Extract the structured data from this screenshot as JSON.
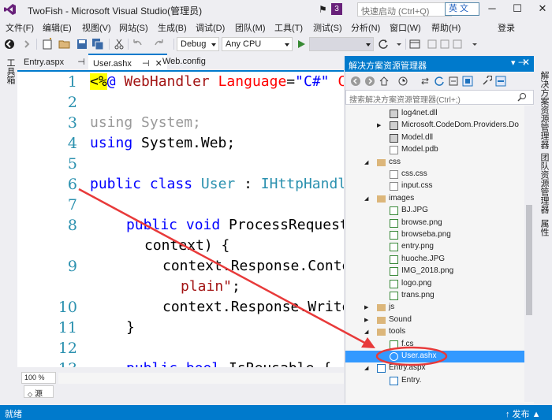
{
  "window": {
    "title": "TwoFish - Microsoft Visual Studio(管理员)",
    "notification_count": "3",
    "quick_launch_placeholder": "快速启动 (Ctrl+Q)",
    "ime_label": "英 文"
  },
  "menu": {
    "items": [
      "文件(F)",
      "编辑(E)",
      "视图(V)",
      "网站(S)",
      "生成(B)",
      "调试(D)",
      "团队(M)",
      "工具(T)",
      "测试(S)",
      "分析(N)",
      "窗口(W)",
      "帮助(H)"
    ],
    "login": "登录"
  },
  "toolbar": {
    "config": "Debug",
    "platform": "Any CPU"
  },
  "left_strip": {
    "toolbox": "工具箱"
  },
  "tabs": [
    {
      "label": "Entry.aspx",
      "pin": "⊣",
      "active": false
    },
    {
      "label": "User.ashx",
      "pin": "⊣",
      "close": "✕",
      "active": true
    },
    {
      "label": "Web.config",
      "active": false
    }
  ],
  "editor": {
    "line_numbers": [
      "1",
      "2",
      "3",
      "4",
      "5",
      "6",
      "7",
      "8",
      "9",
      "10",
      "11",
      "12",
      "13"
    ],
    "zoom": "100 %",
    "source_tab": "源"
  },
  "solution_explorer": {
    "title": "解决方案资源管理器",
    "search_placeholder": "搜索解决方案资源管理器(Ctrl+;)",
    "items": [
      {
        "label": "log4net.dll",
        "type": "dll",
        "level": 3
      },
      {
        "label": "Microsoft.CodeDom.Providers.Do",
        "type": "dll",
        "level": 3,
        "expander": "▶"
      },
      {
        "label": "Model.dll",
        "type": "dll",
        "level": 3
      },
      {
        "label": "Model.pdb",
        "type": "file",
        "level": 3
      },
      {
        "label": "css",
        "type": "folder",
        "level": 2,
        "expander": "◢"
      },
      {
        "label": "css.css",
        "type": "file",
        "level": 3
      },
      {
        "label": "input.css",
        "type": "file",
        "level": 3
      },
      {
        "label": "images",
        "type": "folder",
        "level": 2,
        "expander": "◢"
      },
      {
        "label": "BJ.JPG",
        "type": "image",
        "level": 3
      },
      {
        "label": "browse.png",
        "type": "image",
        "level": 3
      },
      {
        "label": "browseba.png",
        "type": "image",
        "level": 3
      },
      {
        "label": "entry.png",
        "type": "image",
        "level": 3
      },
      {
        "label": "huoche.JPG",
        "type": "image",
        "level": 3
      },
      {
        "label": "IMG_2018.png",
        "type": "image",
        "level": 3
      },
      {
        "label": "logo.png",
        "type": "image",
        "level": 3
      },
      {
        "label": "trans.png",
        "type": "image",
        "level": 3
      },
      {
        "label": "js",
        "type": "folder",
        "level": 2,
        "expander": "▶"
      },
      {
        "label": "Sound",
        "type": "folder",
        "level": 2,
        "expander": "▶"
      },
      {
        "label": "tools",
        "type": "folder",
        "level": 2,
        "expander": "◢"
      },
      {
        "label": "f.cs",
        "type": "cs",
        "level": 3
      },
      {
        "label": "User.ashx",
        "type": "ashx",
        "level": 3,
        "selected": true
      },
      {
        "label": "Entry.aspx",
        "type": "aspx",
        "level": 2,
        "expander": "◢"
      },
      {
        "label": "Entry.",
        "type": "aspx",
        "level": 3
      }
    ]
  },
  "right_strip": [
    "解决方案资源管理器",
    "团队资源管理器",
    "属性"
  ],
  "status": {
    "text": "就绪",
    "publish": "↑ 发布 ▲"
  },
  "colors": {
    "accent": "#007acc",
    "annotation": "#e83a3a",
    "selected_row": "#3399ff"
  }
}
